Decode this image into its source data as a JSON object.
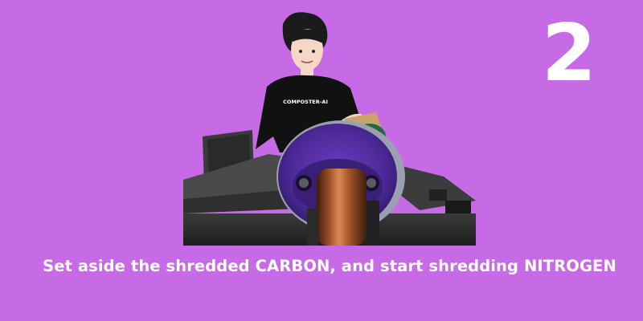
{
  "step": {
    "number": "2",
    "caption": "Set aside the shredded CARBON, and start shredding NITROGEN"
  },
  "illustration": {
    "shirt_text": "COMPOSTER-AI"
  },
  "colors": {
    "background": "#c66ae6",
    "text": "#ffffff",
    "machine": "#2b2b2b",
    "drum": "#4b2c8c",
    "roller": "#a5552c"
  }
}
